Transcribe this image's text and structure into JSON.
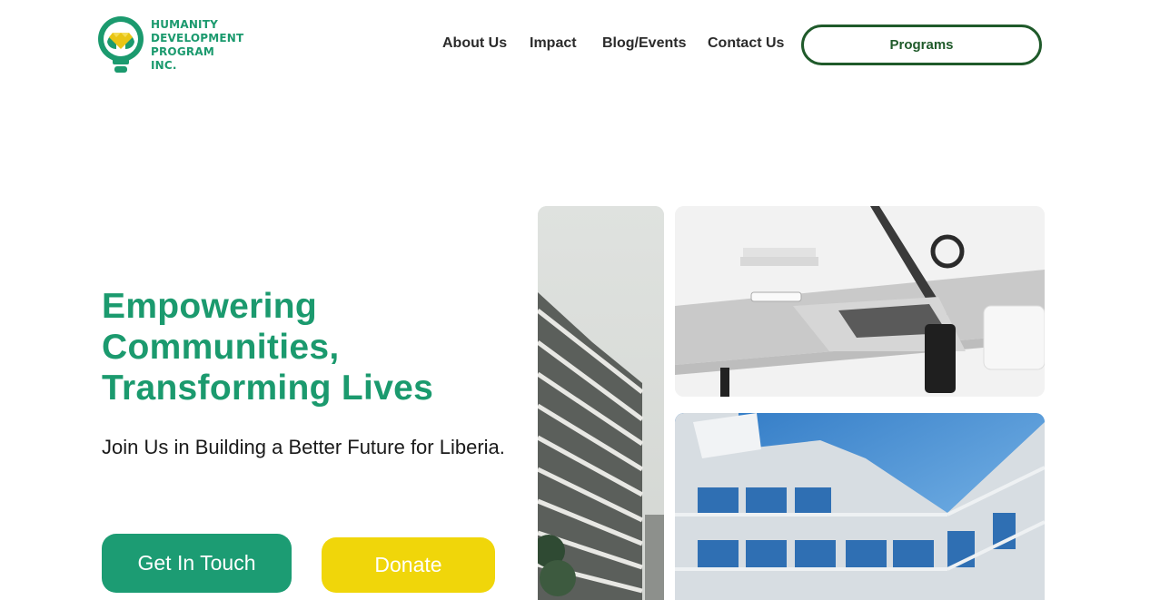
{
  "header": {
    "logo_lines": [
      "HUMANITY",
      "DEVELOPMENT",
      "PROGRAM INC."
    ],
    "nav": [
      {
        "label": "About Us"
      },
      {
        "label": "Impact"
      },
      {
        "label": "Blog/Events"
      },
      {
        "label": "Contact Us"
      }
    ],
    "programs_label": "Programs"
  },
  "hero": {
    "title_lines": [
      "Empowering",
      "Communities,",
      "Transforming Lives"
    ],
    "subtitle": "Join Us in Building a Better Future for Liberia.",
    "get_in_touch_label": "Get In Touch",
    "donate_label": "Donate"
  },
  "images": [
    {
      "name": "building-tall-photo",
      "icon": "building-photo"
    },
    {
      "name": "desk-laptop-photo",
      "icon": "laptop-photo"
    },
    {
      "name": "glass-building-photo",
      "icon": "building-photo"
    }
  ],
  "colors": {
    "brand_green": "#1b9a6e",
    "button_green": "#1c9c73",
    "dark_green_border": "#1f5a2a",
    "donate_yellow": "#f0d60a",
    "logo_gold": "#e9c515"
  }
}
